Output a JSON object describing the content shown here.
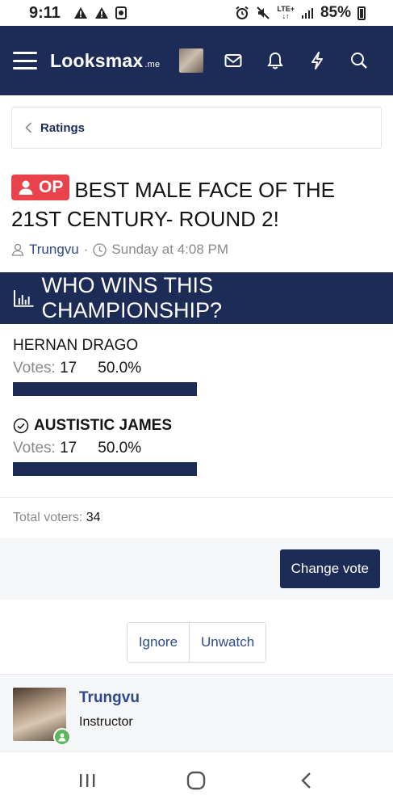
{
  "status_bar": {
    "time": "9:11",
    "network": "LTE+",
    "battery": "85%"
  },
  "nav": {
    "logo_main": "Looksmax",
    "logo_suffix": ".me"
  },
  "breadcrumb": {
    "label": "Ratings"
  },
  "thread": {
    "badge": "OP",
    "title": "BEST MALE FACE OF THE 21ST CENTURY- ROUND 2!",
    "author": "Trungvu",
    "separator": "·",
    "date": "Sunday at 4:08 PM"
  },
  "poll": {
    "question": "WHO WINS THIS CHAMPIONSHIP?",
    "votes_label": "Votes:",
    "options": [
      {
        "name": "HERNAN DRAGO",
        "votes": "17",
        "percent": "50.0%",
        "fraction": 0.5,
        "voted": false
      },
      {
        "name": "AUSTISTIC JAMES",
        "votes": "17",
        "percent": "50.0%",
        "fraction": 0.5,
        "voted": true
      }
    ],
    "total_label": "Total voters:",
    "total_value": "34",
    "change_vote_label": "Change vote"
  },
  "actions": {
    "ignore_label": "Ignore",
    "unwatch_label": "Unwatch"
  },
  "post_user": {
    "name": "Trungvu",
    "title": "Instructor"
  },
  "colors": {
    "brand": "#1c2c57",
    "op_badge": "#e8424a",
    "online": "#5cb85c",
    "link": "#2d4a8a"
  }
}
